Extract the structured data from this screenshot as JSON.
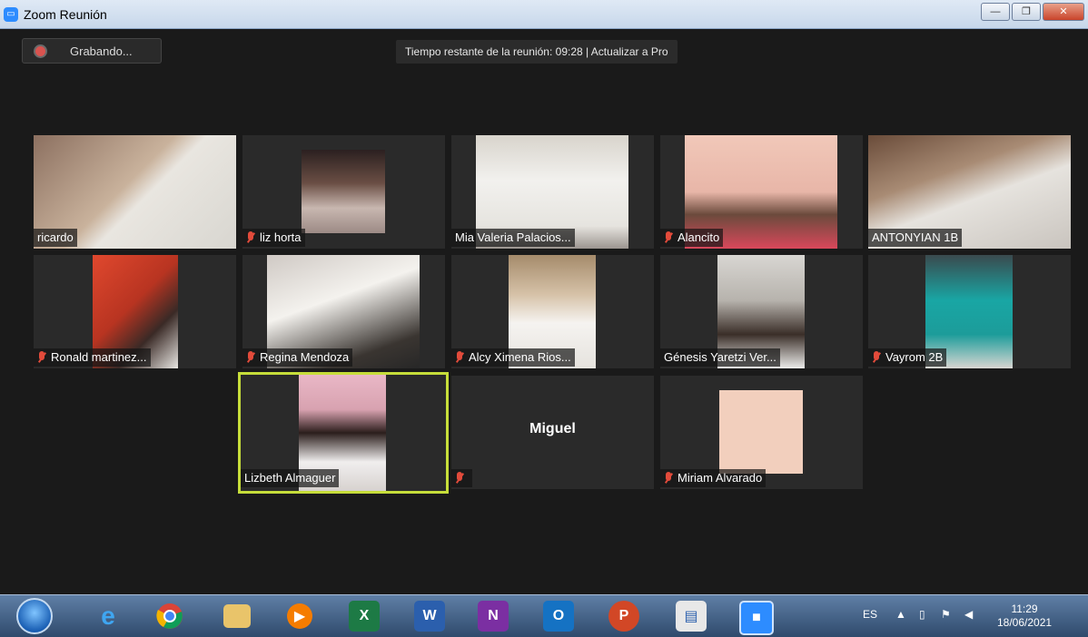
{
  "window": {
    "title": "Zoom Reunión"
  },
  "toolbar": {
    "recording_label": "Grabando...",
    "timer_text": "Tiempo restante de la reunión: 09:28 | Actualizar a Pro"
  },
  "participants": [
    {
      "name": "ricardo",
      "muted": false
    },
    {
      "name": "liz horta",
      "muted": true
    },
    {
      "name": "Mia Valeria Palacios...",
      "muted": false
    },
    {
      "name": "Alancito",
      "muted": true
    },
    {
      "name": "ANTONYIAN 1B",
      "muted": false
    },
    {
      "name": "Ronald  martinez...",
      "muted": true
    },
    {
      "name": "Regina Mendoza",
      "muted": true
    },
    {
      "name": "Alcy Ximena Rios...",
      "muted": true
    },
    {
      "name": "Génesis Yaretzi Ver...",
      "muted": false
    },
    {
      "name": "Vayrom 2B",
      "muted": true
    },
    {
      "name": "Lizbeth Almaguer",
      "muted": false,
      "active_speaker": true
    },
    {
      "name": "Miguel",
      "muted": true,
      "video": false
    },
    {
      "name": "Miriam Alvarado",
      "muted": true
    }
  ],
  "taskbar": {
    "language": "ES",
    "time": "11:29",
    "date": "18/06/2021"
  },
  "colors": {
    "active_speaker_border": "#c6dd3a",
    "mute_icon": "#e24b3b",
    "background": "#1a1a1a"
  }
}
